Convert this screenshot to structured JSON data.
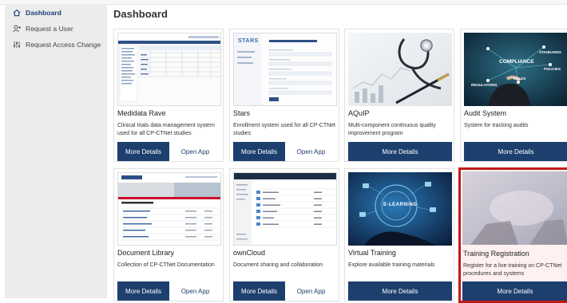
{
  "page": {
    "title": "Dashboard"
  },
  "sidebar": {
    "items": [
      {
        "label": "Dashboard",
        "icon": "home-icon",
        "active": true
      },
      {
        "label": "Request a User",
        "icon": "add-user-icon"
      },
      {
        "label": "Request Access Change",
        "icon": "sliders-icon"
      }
    ]
  },
  "colors": {
    "primary": "#1d3f6e",
    "highlight": "#c21a1a",
    "sidebar": "#ececec"
  },
  "cards": [
    {
      "title": "Medidata Rave",
      "desc": "Clinical trials data management system used for all CP-CTNet studies",
      "more": "More Details",
      "open": "Open App"
    },
    {
      "title": "Stars",
      "desc": "Enrollment system used for all CP-CTNet studies",
      "more": "More Details",
      "open": "Open App",
      "thumb_logo": "STARS"
    },
    {
      "title": "AQuIP",
      "desc": "Multi-component continuous quality improvement program",
      "more": "More Details"
    },
    {
      "title": "Audit System",
      "desc": "System for tracking audits",
      "more": "More Details",
      "thumb_words": [
        "COMPLIANCE",
        "STANDARDS",
        "POLICIES",
        "REGULATIONS",
        "RULES"
      ]
    },
    {
      "title": "Document Library",
      "desc": "Collection of CP-CTNet Documentation",
      "more": "More Details",
      "open": "Open App"
    },
    {
      "title": "ownCloud",
      "desc": "Document sharing and collaboration",
      "more": "More Details",
      "open": "Open App"
    },
    {
      "title": "Virtual Training",
      "desc": "Explore available training materials",
      "more": "More Details",
      "thumb_text": "E-LEARNING"
    },
    {
      "title": "Training Registration",
      "desc": "Register for a live training on CP-CTNet procedures and systems",
      "more": "More Details"
    }
  ]
}
